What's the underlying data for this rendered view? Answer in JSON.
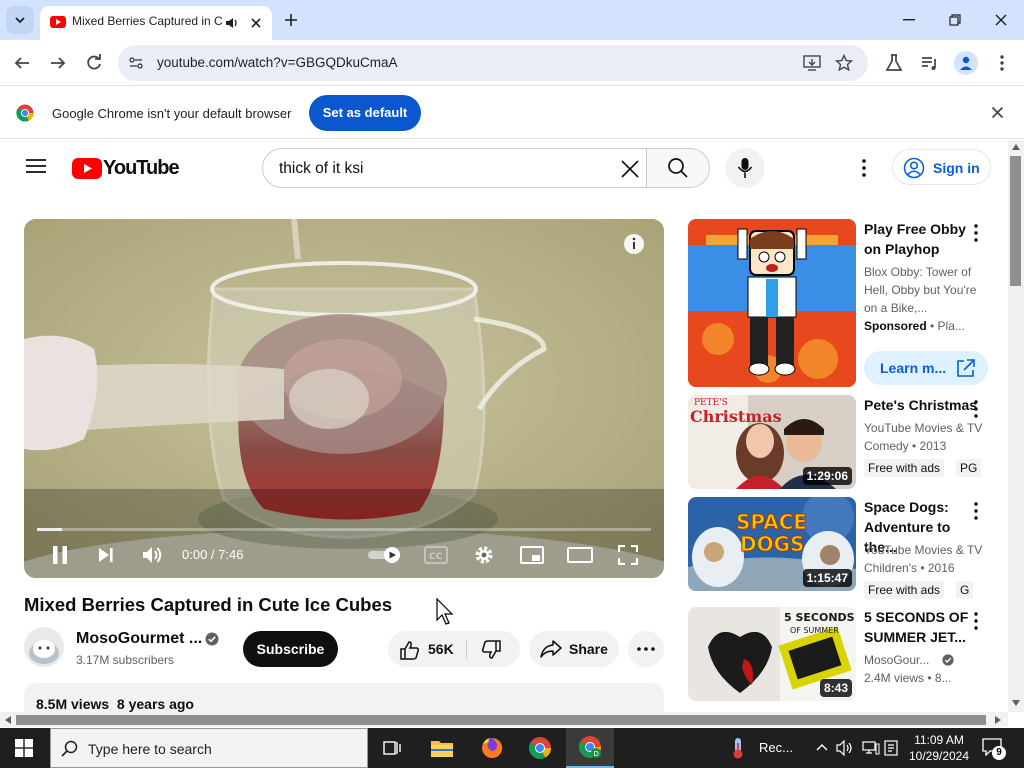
{
  "browser": {
    "tab_title": "Mixed Berries Captured in Cute Ice Cubes",
    "url": "youtube.com/watch?v=GBGQDkuCmaA",
    "infobar_message": "Google Chrome isn't your default browser",
    "set_default_label": "Set as default"
  },
  "youtube": {
    "logo_text": "YouTube",
    "search_query": "thick of it ksi",
    "signin_label": "Sign in"
  },
  "player": {
    "time": "0:00 / 7:46",
    "progress_fraction": 0.04
  },
  "video": {
    "title": "Mixed Berries Captured in Cute Ice Cubes",
    "channel": "MosoGourmet ...",
    "subscribers": "3.17M subscribers",
    "subscribe_label": "Subscribe",
    "likes": "56K",
    "share_label": "Share",
    "views_line": "8.5M views  8 years ago"
  },
  "recommendations": [
    {
      "title": "Play Free Obby on Playhop",
      "meta1": "Blox Obby: Tower of Hell, Obby but You're on a Bike,...",
      "sponsored": "Sponsored",
      "sponsor_suffix": " • Pla...",
      "cta": "Learn m..."
    },
    {
      "title": "Pete's Christmas",
      "meta1": "YouTube Movies & TV",
      "meta2": "Comedy • 2013",
      "badge": "Free with ads",
      "rating": "PG",
      "duration": "1:29:06",
      "thumb_text": "PETE'S Christmas"
    },
    {
      "title": "Space Dogs: Adventure to the...",
      "meta1": "YouTube Movies & TV",
      "meta2": "Children's • 2016",
      "badge": "Free with ads",
      "rating": "G",
      "duration": "1:15:47",
      "thumb_text": "SPACE DOGS"
    },
    {
      "title": "5 SECONDS OF SUMMER JET...",
      "meta1": "MosoGour...",
      "meta2": "2.4M views • 8...",
      "duration": "8:43",
      "thumb_text": "5 SECONDS OF SUMMER"
    }
  ],
  "taskbar": {
    "search_placeholder": "Type here to search",
    "tray_app_label": "Rec...",
    "time": "11:09 AM",
    "date": "10/29/2024",
    "notification_count": "9"
  },
  "colors": {
    "youtube_red": "#ff0000",
    "chrome_blue": "#0b57d0",
    "link_blue": "#065fd4"
  }
}
